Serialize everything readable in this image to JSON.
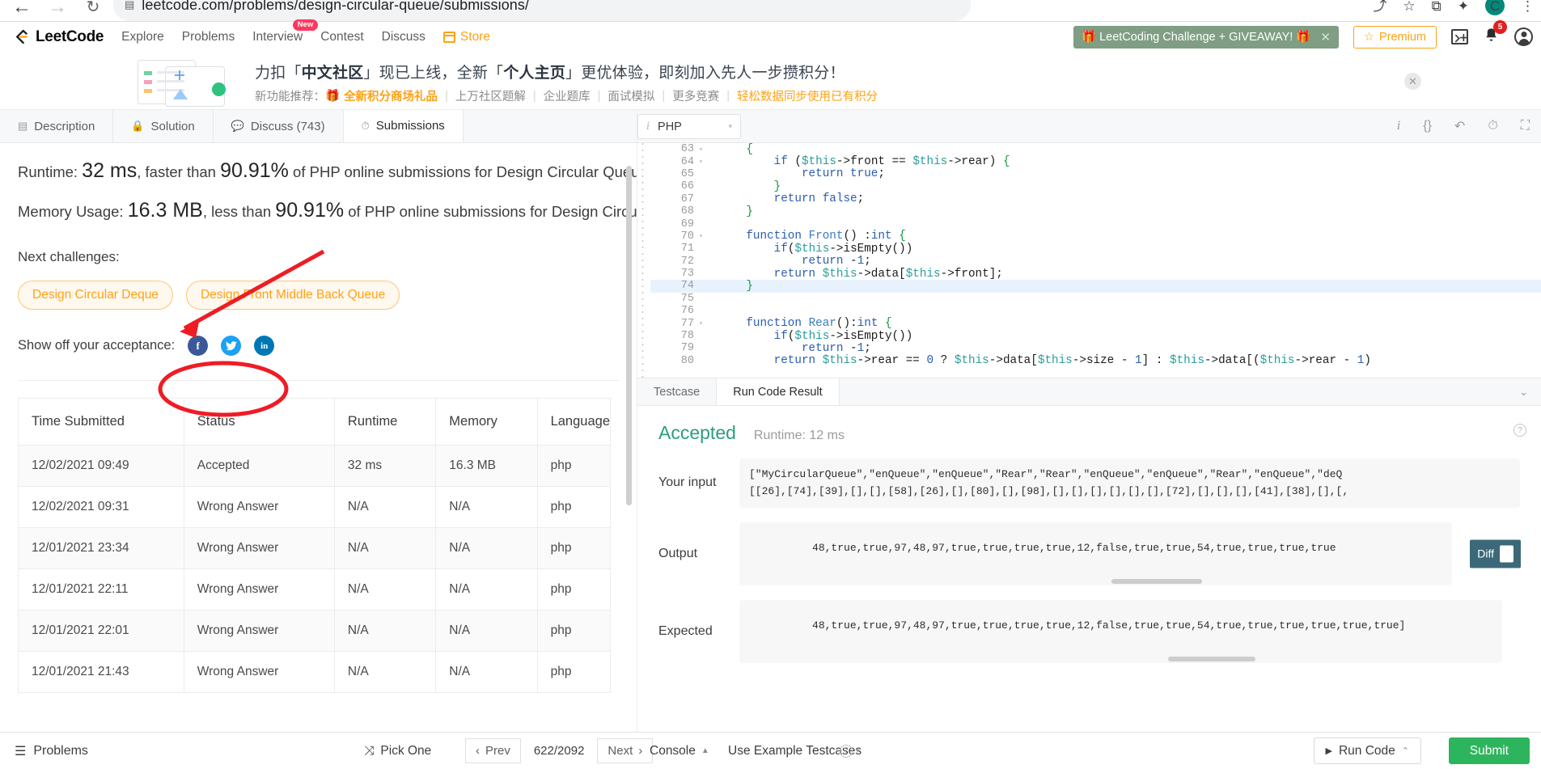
{
  "browser": {
    "url": "leetcode.com/problems/design-circular-queue/submissions/",
    "back_icon": "←",
    "forward_icon": "→",
    "reload_icon": "↻",
    "lock_icon": "▤",
    "share_icon": "⤴",
    "star_icon": "☆",
    "extension_icon": "⧉",
    "puzzle_icon": "✦",
    "menu_icon": "⋮",
    "profile_initial": "C"
  },
  "nav": {
    "brand": "LeetCode",
    "links": [
      {
        "label": "Explore",
        "badge": ""
      },
      {
        "label": "Problems",
        "badge": ""
      },
      {
        "label": "Interview",
        "badge": "New"
      },
      {
        "label": "Contest",
        "badge": ""
      },
      {
        "label": "Discuss",
        "badge": ""
      }
    ],
    "store_label": "Store",
    "promo_text": "🎁 LeetCoding Challenge + GIVEAWAY! 🎁",
    "promo_close": "✕",
    "premium_label": "Premium",
    "premium_star": "☆",
    "terminal_icon": "〉+",
    "bell_icon": "🔔",
    "bell_count": "5",
    "user_icon": "user-avatar"
  },
  "cn_banner": {
    "line1_a": "力扣「",
    "line1_b": "中文社区",
    "line1_c": "」现已上线，全新「",
    "line1_d": "个人主页",
    "line1_e": "」更优体验，即刻加入先人一步攒积分！",
    "line2_label": "新功能推荐：",
    "line2_links": [
      "全新积分商场礼品",
      "上万社区题解",
      "企业题库",
      "面试模拟",
      "更多竞赛"
    ],
    "line2_highlight": "轻松数据同步使用已有积分",
    "gift_icon": "🎁",
    "close_icon": "✕"
  },
  "tabs": [
    {
      "label": "Description",
      "icon": "▤",
      "active": false
    },
    {
      "label": "Solution",
      "icon": "🔒",
      "active": false
    },
    {
      "label": "Discuss (743)",
      "icon": "💬",
      "active": false
    },
    {
      "label": "Submissions",
      "icon": "⏱",
      "active": true
    }
  ],
  "result_summary": {
    "runtime_prefix": "Runtime: ",
    "runtime_value": "32 ms",
    "runtime_mid": ", faster than ",
    "runtime_pct": "90.91%",
    "runtime_suffix": " of PHP online submissions for Design Circular Queue.",
    "memory_prefix": "Memory Usage: ",
    "memory_value": "16.3 MB",
    "memory_mid": ", less than ",
    "memory_pct": "90.91%",
    "memory_suffix": " of PHP online submissions for Design Circular Queue.",
    "next_challenges_label": "Next challenges:",
    "challenges": [
      "Design Circular Deque",
      "Design Front Middle Back Queue"
    ],
    "share_label": "Show off your acceptance:",
    "share_icons": [
      "facebook-icon",
      "twitter-icon",
      "linkedin-icon"
    ]
  },
  "table": {
    "headers": [
      "Time Submitted",
      "Status",
      "Runtime",
      "Memory",
      "Language"
    ],
    "rows": [
      {
        "time": "12/02/2021 09:49",
        "status": "Accepted",
        "runtime": "32 ms",
        "memory": "16.3 MB",
        "language": "php",
        "accepted": true
      },
      {
        "time": "12/02/2021 09:31",
        "status": "Wrong Answer",
        "runtime": "N/A",
        "memory": "N/A",
        "language": "php",
        "accepted": false
      },
      {
        "time": "12/01/2021 23:34",
        "status": "Wrong Answer",
        "runtime": "N/A",
        "memory": "N/A",
        "language": "php",
        "accepted": false
      },
      {
        "time": "12/01/2021 22:11",
        "status": "Wrong Answer",
        "runtime": "N/A",
        "memory": "N/A",
        "language": "php",
        "accepted": false
      },
      {
        "time": "12/01/2021 22:01",
        "status": "Wrong Answer",
        "runtime": "N/A",
        "memory": "N/A",
        "language": "php",
        "accepted": false
      },
      {
        "time": "12/01/2021 21:43",
        "status": "Wrong Answer",
        "runtime": "N/A",
        "memory": "N/A",
        "language": "php",
        "accepted": false
      }
    ]
  },
  "editor": {
    "language": "PHP",
    "info_icon": "i",
    "caret_icon": "▾",
    "icons": [
      "info-icon",
      "braces-icon",
      "reset-icon",
      "history-icon",
      "fullscreen-icon"
    ],
    "lines": [
      {
        "n": "63",
        "fold": true,
        "text": "    {"
      },
      {
        "n": "64",
        "fold": true,
        "text": "        if ($this->front == $this->rear) {"
      },
      {
        "n": "65",
        "fold": false,
        "text": "            return true;"
      },
      {
        "n": "66",
        "fold": false,
        "text": "        }"
      },
      {
        "n": "67",
        "fold": false,
        "text": "        return false;"
      },
      {
        "n": "68",
        "fold": false,
        "text": "    }"
      },
      {
        "n": "69",
        "fold": false,
        "text": ""
      },
      {
        "n": "70",
        "fold": true,
        "text": "    function Front() :int {"
      },
      {
        "n": "71",
        "fold": false,
        "text": "        if($this->isEmpty())"
      },
      {
        "n": "72",
        "fold": false,
        "text": "            return -1;"
      },
      {
        "n": "73",
        "fold": false,
        "text": "        return $this->data[$this->front];"
      },
      {
        "n": "74",
        "fold": false,
        "text": "    }",
        "highlight": true
      },
      {
        "n": "75",
        "fold": false,
        "text": ""
      },
      {
        "n": "76",
        "fold": false,
        "text": ""
      },
      {
        "n": "77",
        "fold": true,
        "text": "    function Rear():int {"
      },
      {
        "n": "78",
        "fold": false,
        "text": "        if($this->isEmpty())"
      },
      {
        "n": "79",
        "fold": false,
        "text": "            return -1;"
      },
      {
        "n": "80",
        "fold": false,
        "text": "        return $this->rear == 0 ? $this->data[$this->size - 1] : $this->data[($this->rear - 1)"
      }
    ]
  },
  "result_panel": {
    "tabs": [
      {
        "label": "Testcase",
        "active": false
      },
      {
        "label": "Run Code Result",
        "active": true
      }
    ],
    "collapse_icon": "⌄",
    "status": "Accepted",
    "runtime": "Runtime: 12 ms",
    "help_icon": "?",
    "your_input_label": "Your input",
    "your_input_line1": "[\"MyCircularQueue\",\"enQueue\",\"enQueue\",\"Rear\",\"Rear\",\"enQueue\",\"enQueue\",\"Rear\",\"enQueue\",\"deQ",
    "your_input_line2": "[[26],[74],[39],[],[],[58],[26],[],[80],[],[98],[],[],[],[],[],[],[72],[],[],[],[41],[38],[],[,",
    "output_label": "Output",
    "output_value": "48,true,true,97,48,97,true,true,true,true,12,false,true,true,54,true,true,true,true",
    "expected_label": "Expected",
    "expected_value": "48,true,true,97,48,97,true,true,true,true,12,false,true,true,54,true,true,true,true,true,true]",
    "diff_label": "Diff"
  },
  "bottom_bar": {
    "problems_label": "Problems",
    "problems_icon": "☰",
    "pick_one_label": "Pick One",
    "pick_one_icon": "⤨",
    "prev_label": "Prev",
    "prev_icon": "‹",
    "page_count": "622/2092",
    "next_label": "Next",
    "next_icon": "›",
    "console_label": "Console",
    "console_icon": "▲",
    "use_testcases_label": "Use Example Testcases",
    "help_icon": "?",
    "help_caret": "▾",
    "run_code_label": "Run Code",
    "run_icon": "▶",
    "run_caret": "⌃",
    "submit_label": "Submit"
  },
  "colors": {
    "accent": "#ffa116",
    "accepted": "#2e9c7e",
    "wrong": "#c0392b",
    "submit": "#2db55d",
    "annotation": "#ee1c25"
  }
}
